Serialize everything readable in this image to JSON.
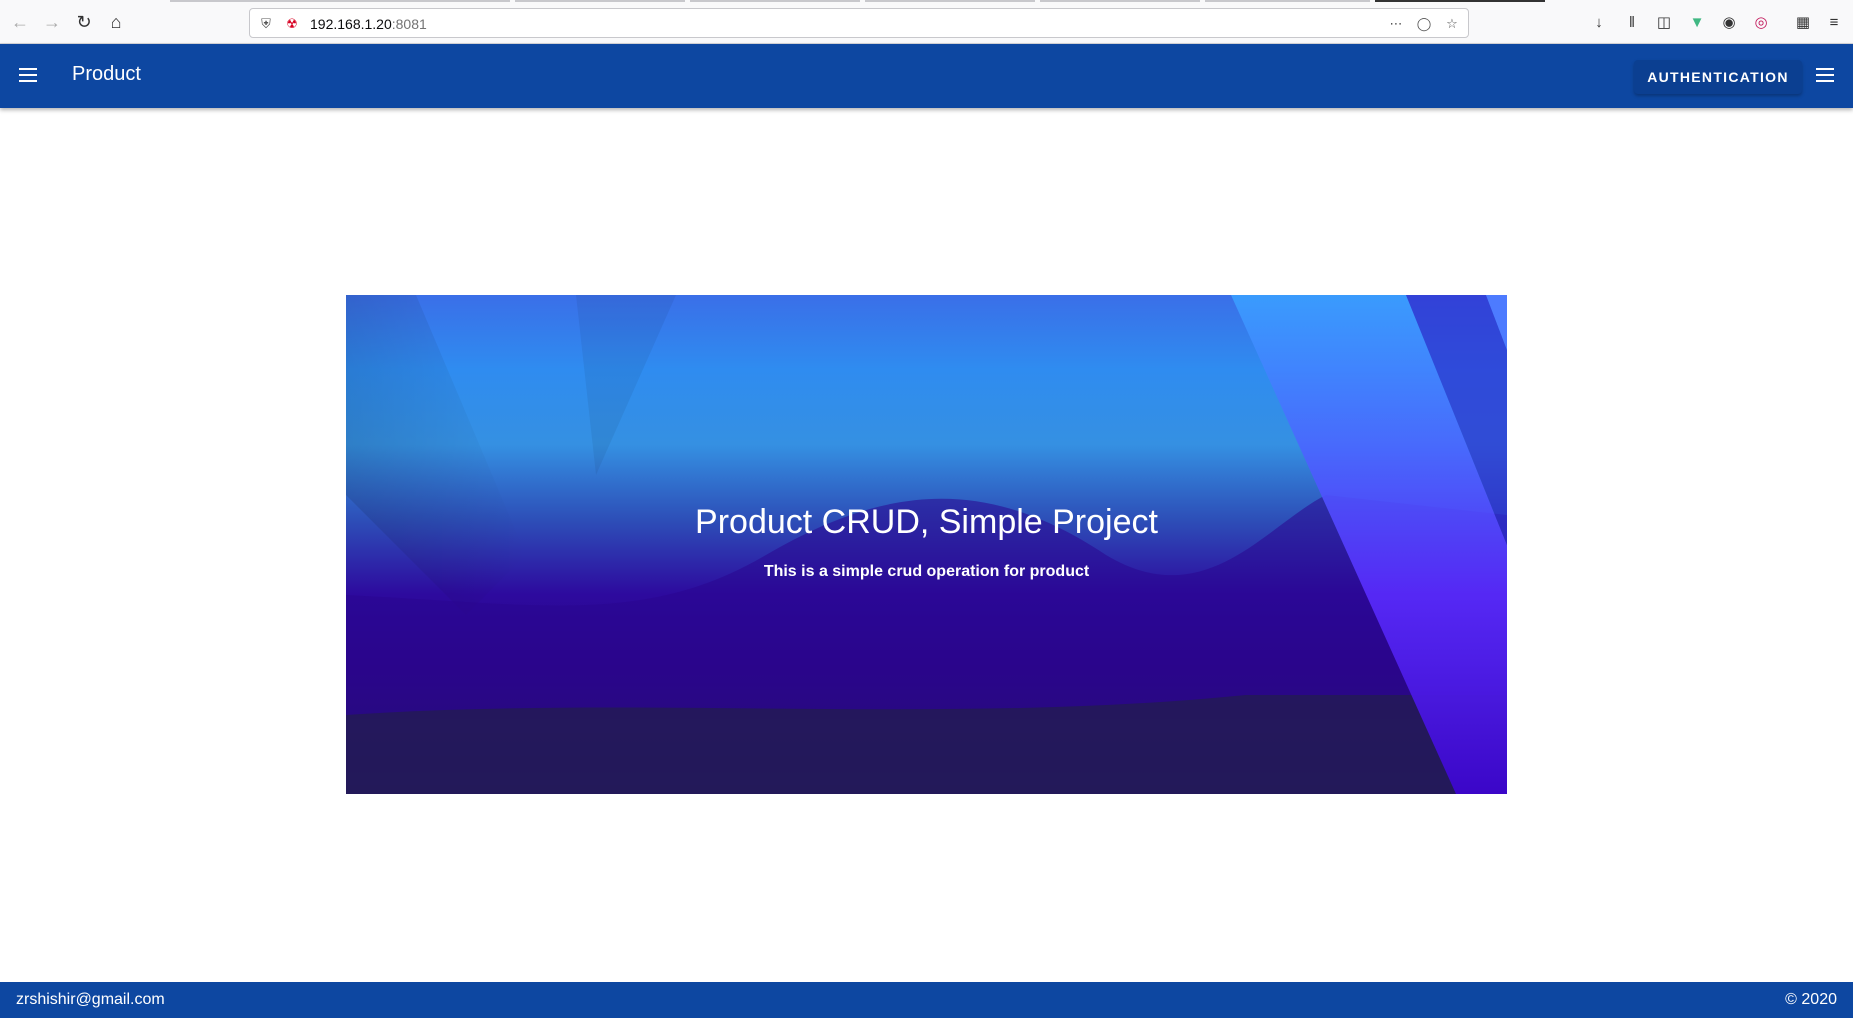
{
  "browser": {
    "url_host": "192.168.1.20",
    "url_port": ":8081",
    "icons": [
      "back-icon",
      "forward-icon",
      "reload-icon",
      "home-icon",
      "shield-icon",
      "insecure-lock-icon",
      "more-icon",
      "pocket-icon",
      "bookmark-star-icon",
      "downloads-icon",
      "library-icon",
      "sidebar-icon",
      "vue-devtools-icon",
      "account-icon",
      "color-picker-icon",
      "extensions-icon",
      "app-menu-icon"
    ]
  },
  "app_bar": {
    "title": "Product",
    "auth_button": "AUTHENTICATION",
    "color": "#0d47a1"
  },
  "hero": {
    "title": "Product CRUD, Simple Project",
    "subtitle": "This is a simple crud operation for product"
  },
  "footer": {
    "email": "zrshishir@gmail.com",
    "copyright": "© 2020"
  }
}
